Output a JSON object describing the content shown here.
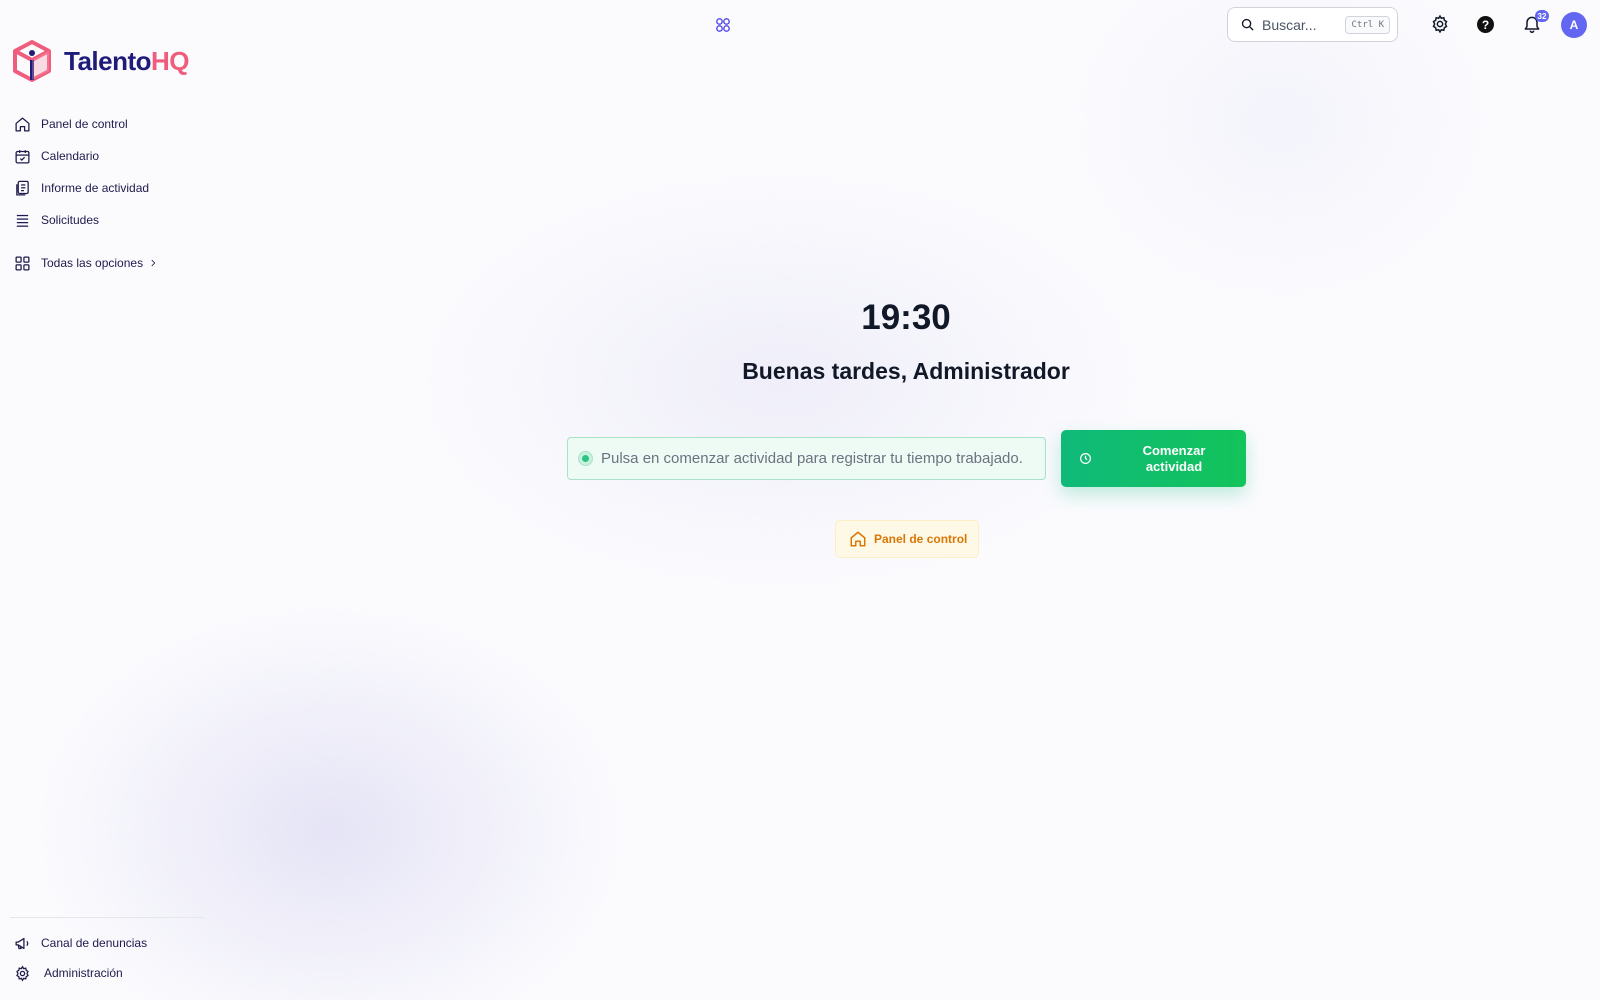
{
  "brand": {
    "name_part1": "Talento",
    "name_part2": "HQ",
    "colors": {
      "primary": "#1e1b7a",
      "accent": "#f05c7c"
    }
  },
  "sidebar": {
    "items": [
      {
        "label": "Panel de control",
        "icon": "home-icon"
      },
      {
        "label": "Calendario",
        "icon": "calendar-icon"
      },
      {
        "label": "Informe de actividad",
        "icon": "report-icon"
      },
      {
        "label": "Solicitudes",
        "icon": "list-icon"
      }
    ],
    "all_options": {
      "label": "Todas las opciones",
      "icon": "grid-icon"
    },
    "bottom_items": [
      {
        "label": "Canal de denuncias",
        "icon": "megaphone-icon"
      },
      {
        "label": "Administración",
        "icon": "gear-icon"
      }
    ]
  },
  "topbar": {
    "search": {
      "placeholder": "Buscar...",
      "shortcut": "Ctrl K"
    },
    "notifications_count": "32",
    "avatar_initial": "A"
  },
  "main": {
    "time": "19:30",
    "greeting": "Buenas tardes, Administrador",
    "status_text": "Pulsa en comenzar actividad para registrar tu tiempo trabajado.",
    "start_button_label": "Comenzar actividad",
    "dashboard_button_label": "Panel de control"
  },
  "colors": {
    "success": "#10b97a",
    "warning": "#d97706",
    "indigo": "#6366f1"
  }
}
